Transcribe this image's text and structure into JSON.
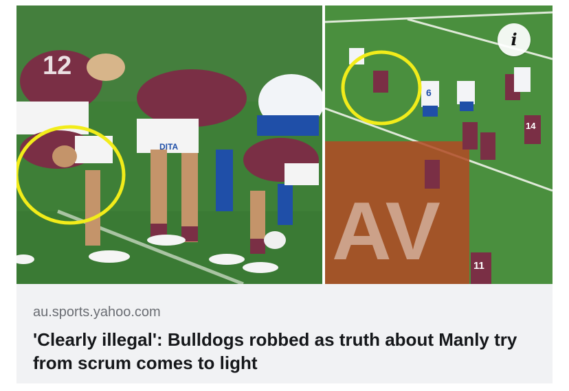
{
  "article": {
    "source": "au.sports.yahoo.com",
    "headline": "'Clearly illegal': Bulldogs robbed as truth about Manly try from scrum comes to light"
  },
  "info_button": {
    "label": "i"
  },
  "photo_left": {
    "jersey_number": "12",
    "sponsor": "DITA"
  },
  "photo_right": {
    "jersey_numbers": [
      "6",
      "14",
      "11"
    ],
    "sponsor_watermark": "AV"
  },
  "colors": {
    "highlight_circle": "#f2ec1a",
    "manly_maroon": "#7a2f45",
    "bulldogs_blue": "#1f4fa8",
    "grass": "#3f8a3c",
    "sponsor_ad": "#b24a25"
  }
}
